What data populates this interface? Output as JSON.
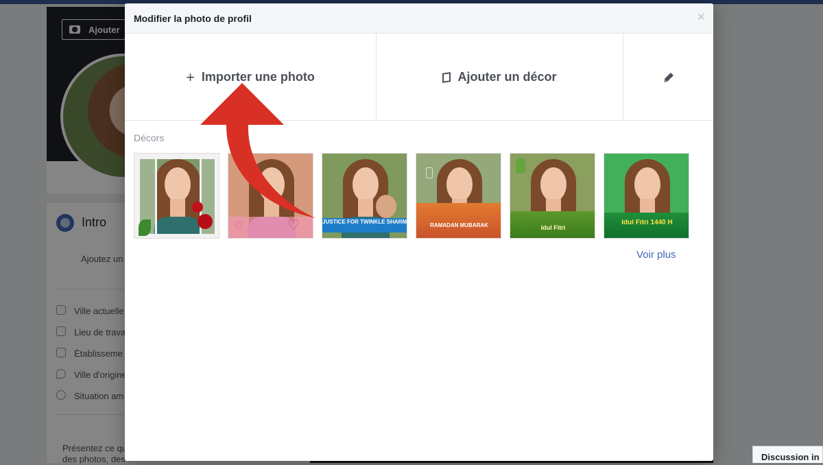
{
  "background": {
    "cover_button_label": "Ajouter",
    "intro": {
      "title": "Intro",
      "add_text": "Ajoutez un",
      "rows": [
        {
          "label": "Ville actuelle",
          "icon": "home-icon"
        },
        {
          "label": "Lieu de trava",
          "icon": "briefcase-icon"
        },
        {
          "label": "Établisseme",
          "icon": "graduation-icon"
        },
        {
          "label": "Ville d'origine",
          "icon": "location-pin-icon"
        },
        {
          "label": "Situation am",
          "icon": "heart-icon"
        }
      ],
      "footer_line1": "Présentez ce qu",
      "footer_line2": "des photos, des Pages, des groupes et bien plus"
    },
    "chat_label": "Discussion in"
  },
  "modal": {
    "title": "Modifier la photo de profil",
    "close_symbol": "×",
    "actions": {
      "upload_label": "Importer une photo",
      "upload_symbol": "+",
      "frame_label": "Ajouter un décor",
      "edit_icon": "pencil-icon"
    },
    "frames_label": "Décors",
    "frames": [
      {
        "banner": ""
      },
      {
        "banner": ""
      },
      {
        "banner": "JUSTICE FOR TWINKLE SHARMA"
      },
      {
        "banner": "RAMADAN MUBARAK"
      },
      {
        "banner": "Idul Fitri"
      },
      {
        "banner": "Idul Fitri 1440 H"
      }
    ],
    "see_more_label": "Voir plus"
  },
  "colors": {
    "brand_blue": "#3b5998",
    "link_blue": "#4267b2",
    "arrow_red": "#d93025"
  }
}
